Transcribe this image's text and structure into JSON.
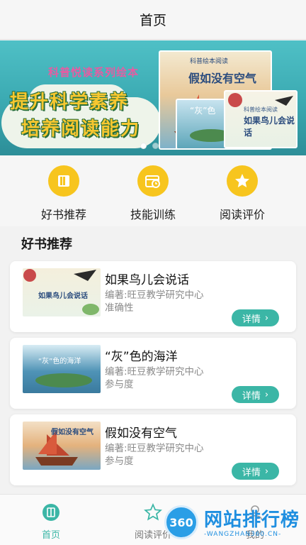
{
  "header": {
    "title": "首页"
  },
  "banner": {
    "subtitle": "科普悦读系列绘本",
    "headline_1": "提升科学素养",
    "headline_2": "培养阅读能力",
    "books": [
      {
        "series": "科普绘本阅读",
        "title": "假如没有空气"
      },
      {
        "title": "“灰”色"
      },
      {
        "series": "科普绘本阅读",
        "title": "如果鸟儿会说话"
      }
    ],
    "page_indicator": {
      "current": 1,
      "total": 2
    }
  },
  "menu": {
    "items": [
      {
        "label": "好书推荐",
        "icon": "book-icon"
      },
      {
        "label": "技能训练",
        "icon": "calendar-clock-icon"
      },
      {
        "label": "阅读评价",
        "icon": "star-icon"
      }
    ]
  },
  "section": {
    "title": "好书推荐"
  },
  "books": [
    {
      "name": "如果鸟儿会说话",
      "author": "编著:旺豆教学研究中心",
      "meta": "准确性",
      "detail_label": "详情",
      "thumb_text": "如果鸟儿会说话"
    },
    {
      "name": "“灰”色的海洋",
      "author": "编著:旺豆教学研究中心",
      "meta": "参与度",
      "detail_label": "详情",
      "thumb_text": "“灰”色的海洋"
    },
    {
      "name": "假如没有空气",
      "author": "编著:旺豆教学研究中心",
      "meta": "参与度",
      "detail_label": "详情",
      "thumb_text": "假如没有空气"
    }
  ],
  "bottom_nav": {
    "items": [
      {
        "label": "首页",
        "icon": "home-book-icon",
        "active": true
      },
      {
        "label": "阅读评价",
        "icon": "star-outline-icon",
        "active": false
      },
      {
        "label": "我的",
        "icon": "user-icon",
        "active": false
      }
    ]
  },
  "watermark": {
    "badge": "360",
    "text": "网站排行榜",
    "sub": "-WANGZHAN360.CN-"
  },
  "colors": {
    "accent": "#3bb6a6",
    "icon_yellow": "#f7c51e",
    "banner_teal": "#3aa9b1"
  }
}
